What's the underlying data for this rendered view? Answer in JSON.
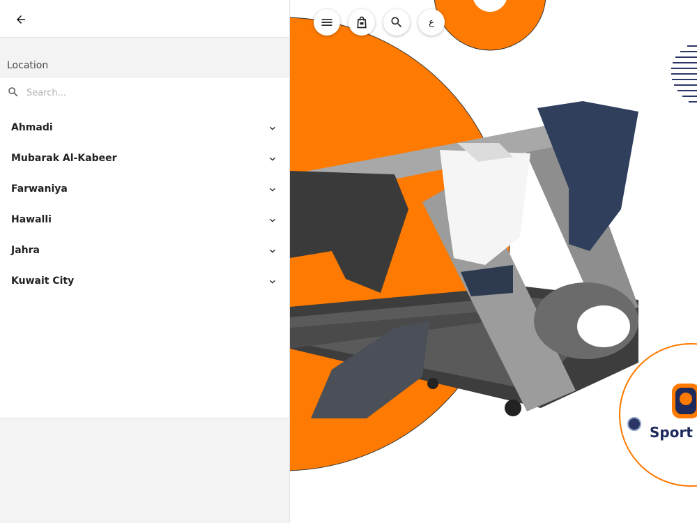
{
  "location": {
    "title": "Location",
    "search": {
      "placeholder": "Search..."
    },
    "regions": [
      {
        "label": "Ahmadi"
      },
      {
        "label": "Mubarak Al-Kabeer"
      },
      {
        "label": "Farwaniya"
      },
      {
        "label": "Hawalli"
      },
      {
        "label": "Jahra"
      },
      {
        "label": "Kuwait City"
      }
    ]
  },
  "header": {
    "language_label": "ع"
  },
  "brand": {
    "partial_text": "Sport"
  },
  "colors": {
    "accent_orange": "#ff7a00",
    "brand_navy": "#1e2a5c"
  },
  "icons": [
    "back-arrow-icon",
    "search-icon",
    "chevron-down-icon",
    "menu-icon",
    "shopping-bag-icon"
  ]
}
